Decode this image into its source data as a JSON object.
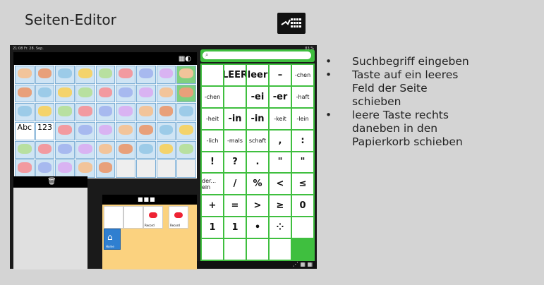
{
  "title": "Seiten-Editor",
  "bullets": [
    {
      "lines": [
        "Suchbegriff eingeben"
      ]
    },
    {
      "lines": [
        "Taste auf ein leeres",
        "Feld der Seite",
        "schieben"
      ]
    },
    {
      "lines": [
        "leere Taste rechts",
        "daneben in den",
        "Papierkorb schieben"
      ]
    }
  ],
  "tablet": {
    "status_left": "21:08  Fr. 28. Sep.",
    "status_right": "83 %",
    "search_placeholder": "",
    "text_keys": [
      "",
      "LEER",
      "leer",
      "–",
      "-chen",
      "-chen",
      "",
      "-ei",
      "-er",
      "-haft",
      "-heit",
      "-in",
      "-in",
      "-keit",
      "-lein",
      "-lich",
      "-mals",
      "schaft",
      ",",
      ":",
      "!",
      "?",
      ".",
      "\"",
      "\"",
      "der... ein",
      "/",
      "%",
      "<",
      "≤",
      "+",
      "=",
      ">",
      "≥",
      "0",
      "1",
      "1",
      "•",
      "⁘",
      "",
      "",
      "",
      "",
      ""
    ],
    "symbol_texts": [
      "Abc",
      "123"
    ],
    "new_labels": [
      "Record",
      "Record",
      "Home"
    ]
  }
}
